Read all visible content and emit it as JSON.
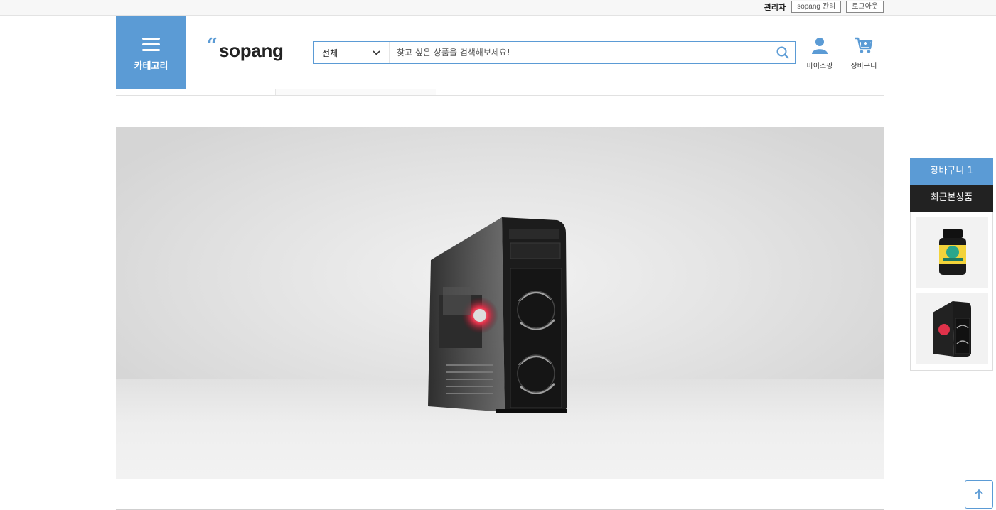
{
  "topbar": {
    "user": "관리자",
    "admin_button": "sopang 관리",
    "logout_button": "로그아웃"
  },
  "header": {
    "category_label": "카테고리",
    "logo_text": "sopang",
    "search": {
      "category_value": "전체",
      "placeholder": "찾고 싶은 상품을 검색해보세요!"
    },
    "mypage_label": "마이소팡",
    "cart_label": "장바구니"
  },
  "side_panel": {
    "cart_label": "장바구니",
    "cart_count": "1",
    "recent_title": "최근본상품",
    "recent_items": [
      "supplement-bottle",
      "pc-case"
    ]
  },
  "colors": {
    "accent": "#5b9bd5",
    "dark": "#222222"
  }
}
